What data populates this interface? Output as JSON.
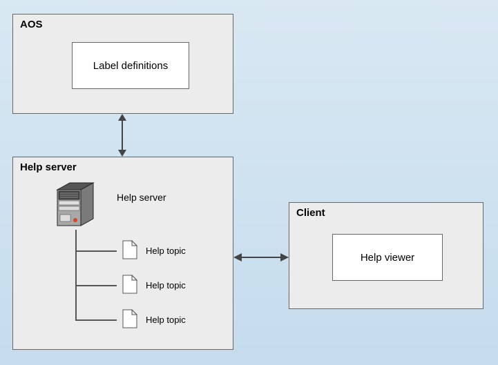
{
  "aos": {
    "title": "AOS",
    "box_label": "Label definitions"
  },
  "help_server": {
    "group_title": "Help server",
    "server_label": "Help server",
    "topics": [
      "Help topic",
      "Help topic",
      "Help topic"
    ]
  },
  "client": {
    "title": "Client",
    "box_label": "Help viewer"
  }
}
